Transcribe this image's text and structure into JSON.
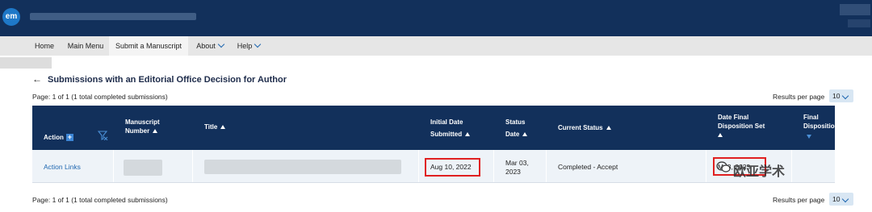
{
  "header": {
    "logo_text": "em"
  },
  "nav": {
    "items": [
      {
        "label": "Home"
      },
      {
        "label": "Main Menu"
      },
      {
        "label": "Submit a Manuscript"
      },
      {
        "label": "About"
      },
      {
        "label": "Help"
      }
    ]
  },
  "page": {
    "title": "Submissions with an Editorial Office Decision for Author",
    "page_info_top": "Page: 1 of 1 (1 total completed submissions)",
    "page_info_bottom": "Page: 1 of 1 (1 total completed submissions)",
    "rpp_label": "Results per page",
    "rpp_value": "10"
  },
  "table": {
    "headers": {
      "action": "Action",
      "manuscript_number": [
        "Manuscript",
        "Number"
      ],
      "title": "Title",
      "initial_date": [
        "Initial Date",
        "Submitted"
      ],
      "status_date": [
        "Status",
        "Date"
      ],
      "current_status": "Current Status",
      "date_final": [
        "Date Final",
        "Disposition Set"
      ],
      "final_disposition": [
        "Final",
        "Disposition"
      ]
    },
    "row": {
      "action": "Action Links",
      "initial_date": "Aug 10, 2022",
      "status_date": [
        "Mar 03,",
        "2023"
      ],
      "current_status": "Completed - Accept",
      "date_final": "M  3, 2023"
    }
  },
  "watermark": {
    "text": "欧亚学术"
  },
  "colors": {
    "header_bg": "#12305b",
    "accent": "#1f67b0",
    "highlight": "#e02020"
  }
}
